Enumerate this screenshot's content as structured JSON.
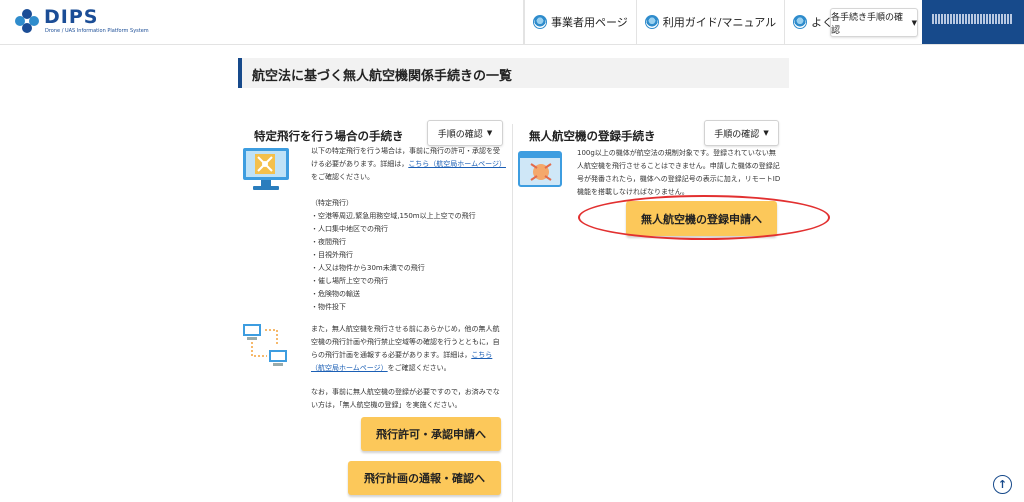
{
  "header": {
    "logo_text": "DIPS",
    "logo_sub": "Drone / UAS Information Platform System",
    "nav": [
      {
        "label": "事業者用ページ",
        "icon": "globe-icon"
      },
      {
        "label": "利用ガイド/マニュアル",
        "icon": "globe-icon"
      },
      {
        "label": "よくある質問",
        "icon": "globe-icon"
      }
    ],
    "steps_button": "各手続き手順の確認",
    "user_name": "xxxxxxxxxxxx"
  },
  "page_title": "航空法に基づく無人航空機関係手続きの一覧",
  "left": {
    "title": "特定飛行を行う場合の手続き",
    "steps_button": "手順の確認",
    "intro_pre": "以下の特定飛行を行う場合は，事前に飛行の許可・承認を受ける必要があります。詳細は，",
    "intro_link": "こちら（航空局ホームページ）",
    "intro_post": "をご確認ください。",
    "list_heading": "（特定飛行）",
    "list": [
      "・空港等周辺,緊急用務空域,150m以上上空での飛行",
      "・人口集中地区での飛行",
      "・夜間飛行",
      "・目視外飛行",
      "・人又は物件から30m未満での飛行",
      "・催し場所上空での飛行",
      "・危険物の輸送",
      "・物件投下"
    ],
    "plan_pre": "また，無人航空機を飛行させる前にあらかじめ，他の無人航空機の飛行計画や飛行禁止空域等の確認を行うとともに，自らの飛行計画を通報する必要があります。詳細は，",
    "plan_link": "こちら（航空局ホームページ）",
    "plan_post": "をご確認ください。",
    "note": "なお，事前に無人航空機の登録が必要ですので，お済みでない方は，「無人航空機の登録」を実施ください。",
    "button_permit": "飛行許可・承認申請へ",
    "button_plan": "飛行計画の通報・確認へ"
  },
  "right": {
    "title": "無人航空機の登録手続き",
    "steps_button": "手順の確認",
    "body": "100g以上の機体が航空法の規制対象です。登録されていない無人航空機を飛行させることはできません。申請した機体の登録記号が発番されたら，機体への登録記号の表示に加え，リモートID機能を搭載しなければなりません。",
    "button_register": "無人航空機の登録申請へ"
  },
  "colors": {
    "brand": "#174a8b",
    "button_yellow": "#fcc85a",
    "highlight": "#e23030"
  }
}
